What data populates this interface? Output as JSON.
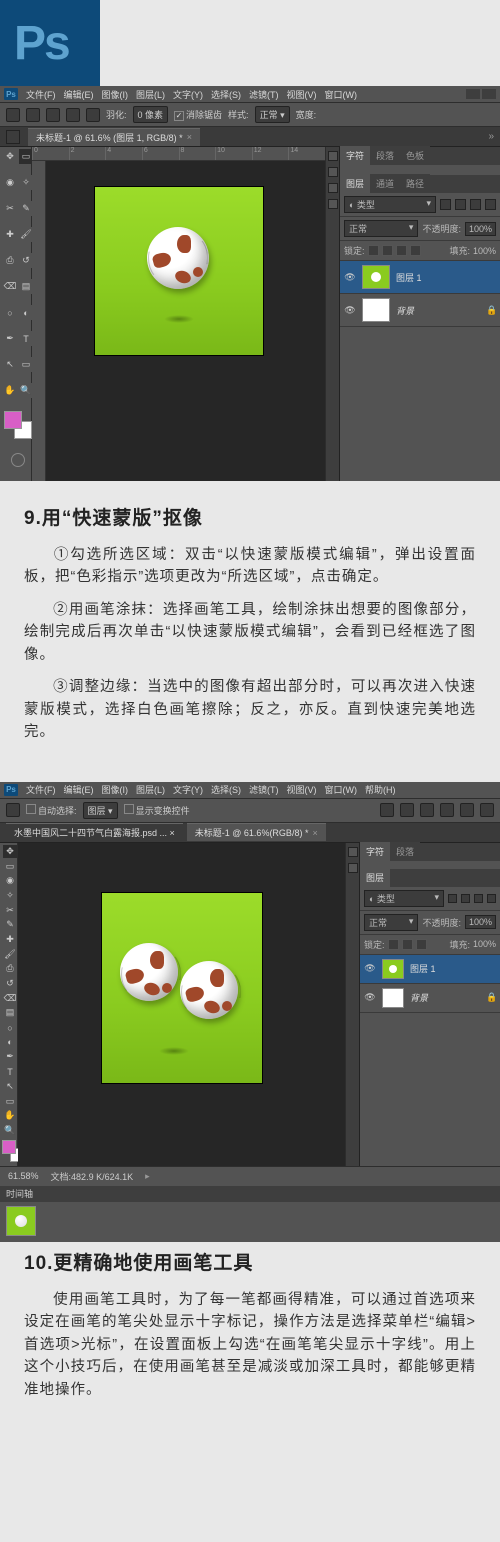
{
  "logo": "Ps",
  "shot1": {
    "menu": [
      "文件(F)",
      "编辑(E)",
      "图像(I)",
      "图层(L)",
      "文字(Y)",
      "选择(S)",
      "滤镜(T)",
      "视图(V)",
      "窗口(W)"
    ],
    "optbar": {
      "feather_label": "羽化:",
      "feather_value": "0 像素",
      "antialias": "消除锯齿",
      "style_label": "样式:",
      "style_value": "正常",
      "width_label": "宽度:"
    },
    "tab": "未标题-1 @ 61.6% (图层 1, RGB/8) *",
    "ruler": [
      "0",
      "2",
      "4",
      "6",
      "8",
      "10",
      "12",
      "14"
    ],
    "panel_tabs_top": [
      "字符",
      "段落",
      "色板"
    ],
    "panel_tabs_mid": [
      "图层",
      "通道",
      "路径"
    ],
    "kind": "◐ 类型",
    "blend": "正常",
    "opacity_label": "不透明度:",
    "opacity_value": "100%",
    "lock_label": "锁定:",
    "fill_label": "填充:",
    "fill_value": "100%",
    "layer1": "图层 1",
    "layer_bg": "背景"
  },
  "article1": {
    "title": "9.用“快速蒙版”抠像",
    "p1": "①勾选所选区域：双击“以快速蒙版模式编辑”，弹出设置面板，把“色彩指示”选项更改为“所选区域”，点击确定。",
    "p2": "②用画笔涂抹：选择画笔工具，绘制涂抹出想要的图像部分，绘制完成后再次单击“以快速蒙版模式编辑”，会看到已经框选了图像。",
    "p3": "③调整边缘：当选中的图像有超出部分时，可以再次进入快速蒙版模式，选择白色画笔擦除；反之，亦反。直到快速完美地选完。"
  },
  "shot2": {
    "menu": [
      "文件(F)",
      "编辑(E)",
      "图像(I)",
      "图层(L)",
      "文字(Y)",
      "选择(S)",
      "滤镜(T)",
      "视图(V)",
      "窗口(W)",
      "帮助(H)"
    ],
    "optbar": {
      "autoselect": "自动选择:",
      "group": "图层",
      "transform": "显示变换控件"
    },
    "tab1": "水墨中国风二十四节气白露海报.psd ... ×",
    "tab2": "未标题-1 @ 61.6%(RGB/8) *",
    "panel_tabs_top": [
      "字符",
      "段落"
    ],
    "panel_tabs_mid": [
      "图层"
    ],
    "kind": "◐ 类型",
    "blend": "正常",
    "opacity_label": "不透明度:",
    "opacity_value": "100%",
    "lock_label": "锁定:",
    "fill_label": "填充:",
    "fill_value": "100%",
    "layer1": "图层 1",
    "layer_bg": "背景",
    "zoom": "61.58%",
    "docinfo_label": "文档:",
    "docinfo_value": "482.9 K/624.1K",
    "timeline": "时间轴"
  },
  "article2": {
    "title": "10.更精确地使用画笔工具",
    "p1": "使用画笔工具时，为了每一笔都画得精准，可以通过首选项来设定在画笔的笔尖处显示十字标记，操作方法是选择菜单栏“编辑>首选项>光标”，在设置面板上勾选“在画笔笔尖显示十字线”。用上这个小技巧后，在使用画笔甚至是减淡或加深工具时，都能够更精准地操作。"
  }
}
